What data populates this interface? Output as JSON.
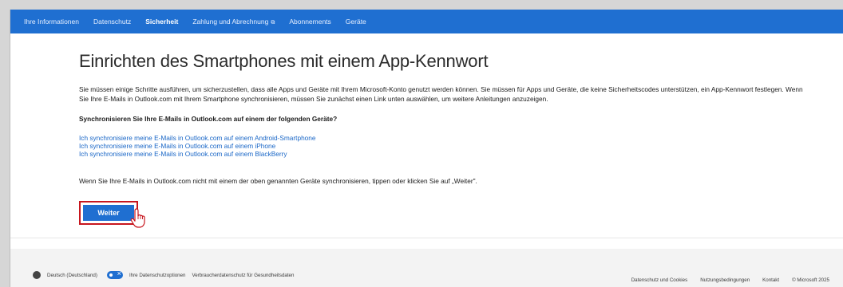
{
  "nav": {
    "items": [
      {
        "label": "Ihre Informationen"
      },
      {
        "label": "Datenschutz"
      },
      {
        "label": "Sicherheit"
      },
      {
        "label": "Zahlung und Abrechnung"
      },
      {
        "label": "Abonnements"
      },
      {
        "label": "Geräte"
      }
    ],
    "external_glyph": "⧉",
    "active_index": 2
  },
  "main": {
    "title": "Einrichten des Smartphones mit einem App-Kennwort",
    "intro": "Sie müssen einige Schritte ausführen, um sicherzustellen, dass alle Apps und Geräte mit Ihrem Microsoft-Konto genutzt werden können. Sie müssen für Apps und Geräte, die keine Sicherheitscodes unterstützen, ein App-Kennwort festlegen. Wenn Sie Ihre E-Mails in Outlook.com mit Ihrem Smartphone synchronisieren, müssen Sie zunächst einen Link unten auswählen, um weitere Anleitungen anzuzeigen.",
    "question": "Synchronisieren Sie Ihre E-Mails in Outlook.com auf einem der folgenden Geräte?",
    "links": [
      {
        "label": "Ich synchronisiere meine E-Mails in Outlook.com auf einem Android-Smartphone"
      },
      {
        "label": "Ich synchronisiere meine E-Mails in Outlook.com auf einem iPhone"
      },
      {
        "label": "Ich synchronisiere meine E-Mails in Outlook.com auf einem BlackBerry"
      }
    ],
    "note": "Wenn Sie Ihre E-Mails in Outlook.com nicht mit einem der oben genannten Geräte synchronisieren, tippen oder klicken Sie auf „Weiter\".",
    "next_button": "Weiter"
  },
  "footer": {
    "language": "Deutsch (Deutschland)",
    "privacy_choices": "Ihre Datenschutzoptionen",
    "health_privacy": "Verbraucherdatenschutz für Gesundheitsdaten",
    "right_links": [
      {
        "label": "Datenschutz und Cookies"
      },
      {
        "label": "Nutzungsbedingungen"
      },
      {
        "label": "Kontakt"
      },
      {
        "label": "© Microsoft 2025"
      }
    ]
  },
  "colors": {
    "nav_bg": "#1f6fd1",
    "link": "#1a67c7",
    "highlight": "#c7161e"
  }
}
